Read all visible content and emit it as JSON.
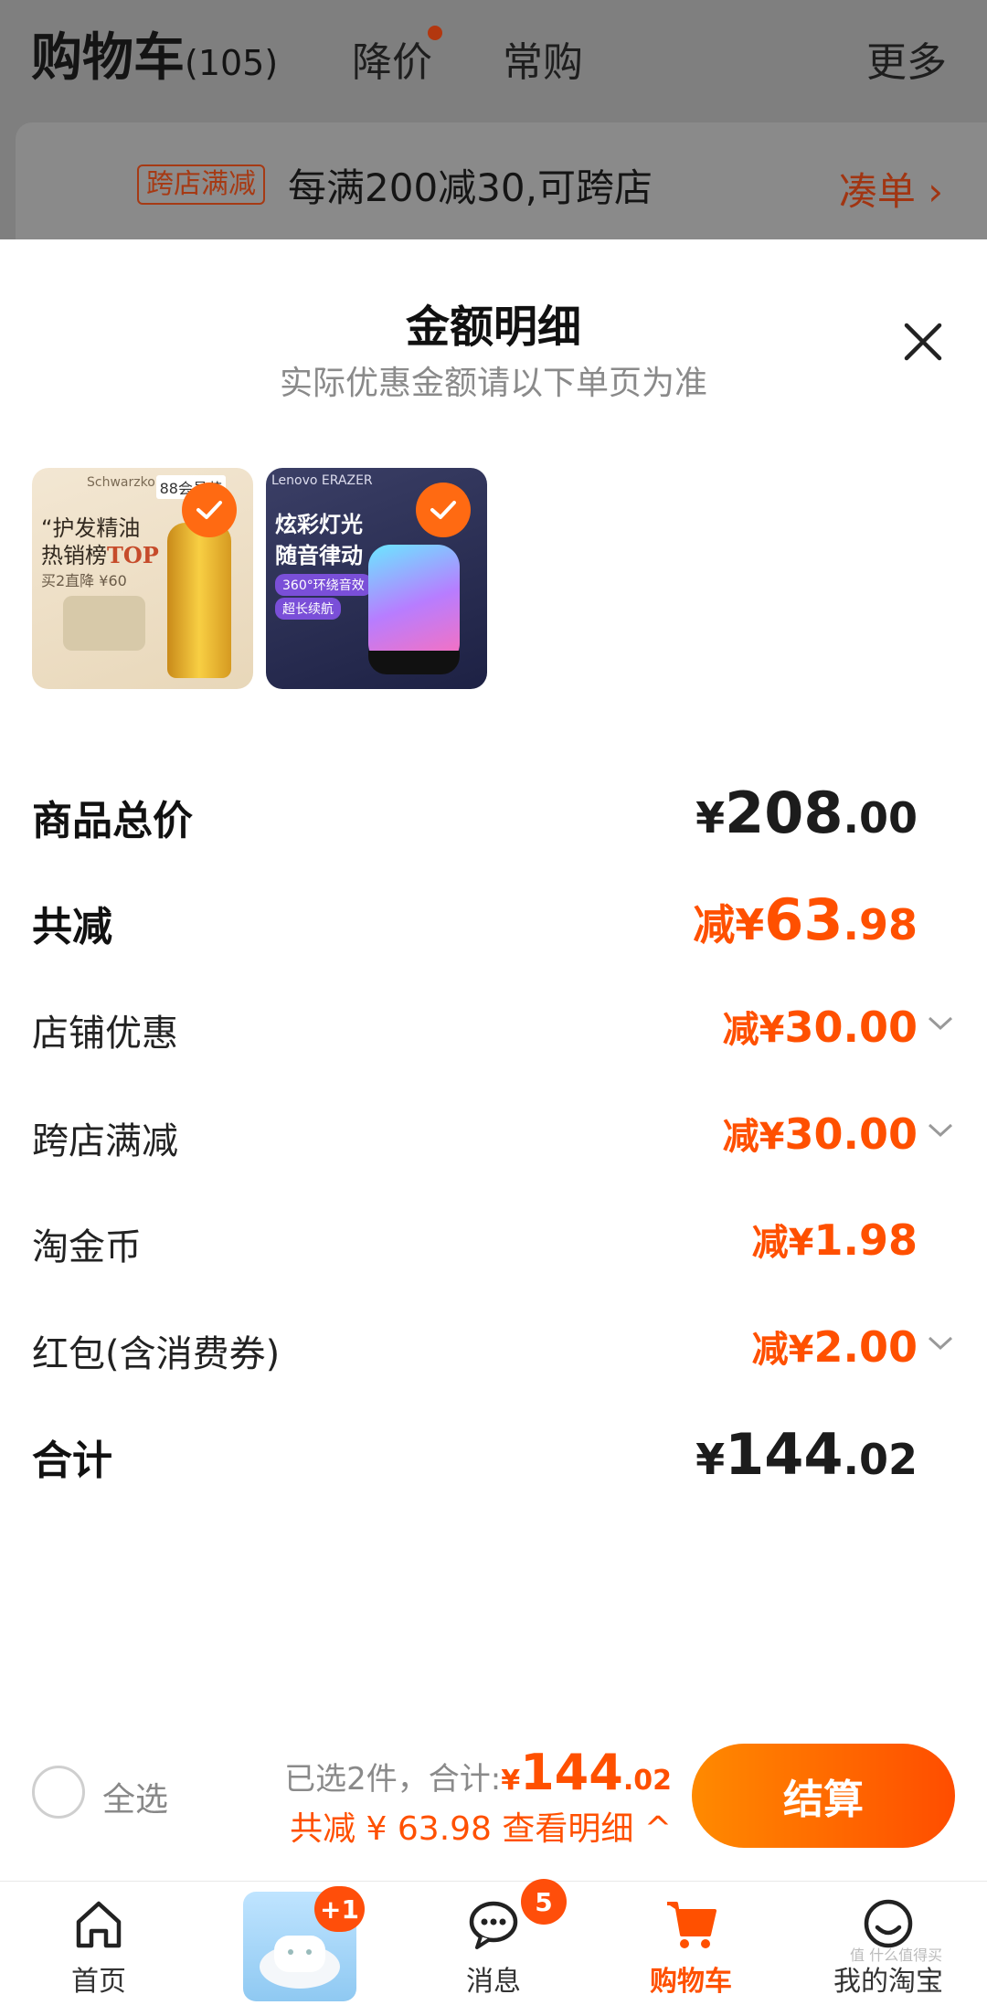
{
  "background_page": {
    "title": "购物车",
    "count": "(105)",
    "tabs": [
      "降价",
      "常购"
    ],
    "more": "更多",
    "promo_tag": "跨店满减",
    "promo_text": "每满200减30,可跨店",
    "promo_link": "凑单 ›"
  },
  "sheet": {
    "title": "金额明细",
    "subtitle": "实际优惠金额请以下单页为准",
    "products": [
      {
        "name": "护发精油",
        "brand": "Schwarzkopf",
        "badge": "88会员节",
        "line1": "“护发精油",
        "line2a": "热销榜",
        "line2b": "TOP 1”",
        "line3": "买2直降 ¥60",
        "selected": true
      },
      {
        "name": "Lenovo ERAZER 音箱",
        "brand": "Lenovo  ERAZER",
        "line1": "炫彩灯光",
        "line2": "随音律动",
        "pill1": "360°环绕音效",
        "pill2": "超长续航",
        "selected": true
      }
    ],
    "rows": [
      {
        "label": "商品总价",
        "prefix": "¥",
        "int": "208",
        "dec": ".00",
        "style": "total-big"
      },
      {
        "label": "共减",
        "prefix": "减¥",
        "int": "63",
        "dec": ".98",
        "style": "discount-big"
      },
      {
        "label": "店铺优惠",
        "prefix": "减¥",
        "int": "30",
        "dec": ".00",
        "style": "discount",
        "expandable": true
      },
      {
        "label": "跨店满减",
        "prefix": "减¥",
        "int": "30",
        "dec": ".00",
        "style": "discount",
        "expandable": true
      },
      {
        "label": "淘金币",
        "prefix": "减¥",
        "int": "1",
        "dec": ".98",
        "style": "discount",
        "expandable": false
      },
      {
        "label": "红包(含消费券)",
        "prefix": "减¥",
        "int": "2",
        "dec": ".00",
        "style": "discount",
        "expandable": true
      },
      {
        "label": "合计",
        "prefix": "¥",
        "int": "144",
        "dec": ".02",
        "style": "total-big"
      }
    ]
  },
  "bottom_bar": {
    "select_all": "全选",
    "selected_text": "已选2件，合计:",
    "total_prefix": "¥",
    "total_int": "144",
    "total_dec": ".02",
    "discount_text": "共减 ¥ 63.98  查看明细 ^",
    "checkout": "结算"
  },
  "tabbar": {
    "items": [
      {
        "label": "首页",
        "icon": "home-icon"
      },
      {
        "label": "",
        "icon": "promo-icon",
        "badge": "+1"
      },
      {
        "label": "消息",
        "icon": "message-icon",
        "badge": "5"
      },
      {
        "label": "购物车",
        "icon": "cart-icon",
        "active": true
      },
      {
        "label": "我的淘宝",
        "icon": "profile-icon"
      }
    ]
  },
  "colors": {
    "accent": "#ff5000",
    "checkout_from": "#ff8a00",
    "checkout_to": "#ff4d00"
  },
  "watermark": "值 什么值得买"
}
